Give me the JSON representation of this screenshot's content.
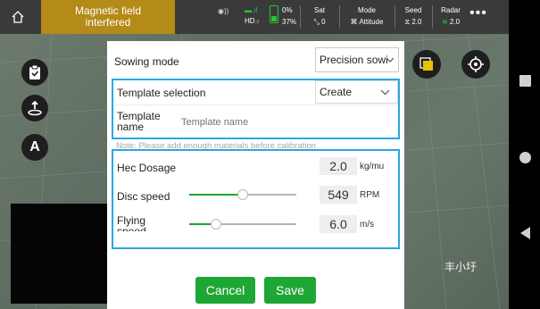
{
  "topbar": {
    "warning_line1": "Magnetic field",
    "warning_line2": "interfered",
    "signal_icon": "wifi-signal-icon",
    "hd_label": "HD",
    "battery_top_pct": "0%",
    "battery_bottom_pct": "37%",
    "sat": {
      "label": "Sat",
      "value": "0"
    },
    "mode": {
      "label": "Mode",
      "value": "Attitude"
    },
    "seed": {
      "label": "Seed",
      "value": "2.0"
    },
    "radar": {
      "label": "Radar",
      "value": "2.0"
    },
    "more_label": "•••",
    "warning_color": "#b48a18",
    "accent_green": "#28c43a"
  },
  "map": {
    "watermark": "丰小圩"
  },
  "dialog": {
    "sowing_mode_label": "Sowing mode",
    "sowing_mode_value": "Precision sowi",
    "template_selection_label": "Template selection",
    "template_selection_value": "Create",
    "template_name_label_line1": "Template",
    "template_name_label_line2": "name",
    "template_name_placeholder": "Template name",
    "note": "Note: Please add enough materials before calibration",
    "hec_dosage": {
      "label": "Hec Dosage",
      "value": "2.0",
      "unit": "kg/mu"
    },
    "disc_speed": {
      "label": "Disc speed",
      "value": "549",
      "unit": "RPM",
      "slider_fraction": 0.5
    },
    "flying_speed": {
      "label_line1": "Flying",
      "label_line2": "speed",
      "value": "6.0",
      "unit": "m/s",
      "slider_fraction": 0.25
    },
    "cancel_label": "Cancel",
    "save_label": "Save",
    "highlight_color": "#29a8e0",
    "button_color": "#1fa735"
  }
}
